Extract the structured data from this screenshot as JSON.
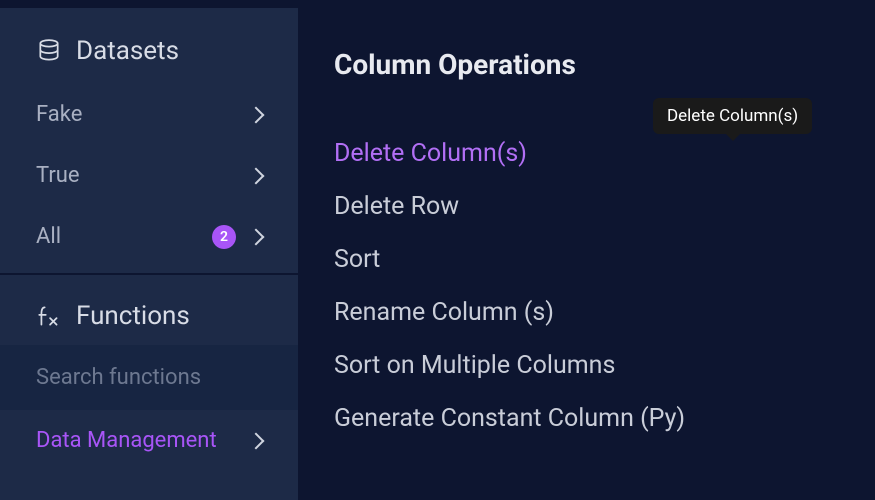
{
  "accent_color": "#a855f7",
  "sidebar": {
    "datasets": {
      "title": "Datasets",
      "items": [
        {
          "label": "Fake",
          "badge": null
        },
        {
          "label": "True",
          "badge": null
        },
        {
          "label": "All",
          "badge": "2"
        }
      ]
    },
    "functions": {
      "title": "Functions",
      "search_placeholder": "Search functions",
      "items": [
        {
          "label": "Data Management",
          "active": true
        }
      ]
    }
  },
  "main": {
    "title": "Column Operations",
    "tooltip": "Delete Column(s)",
    "operations": [
      {
        "label": "Delete Column(s)",
        "highlighted": true
      },
      {
        "label": "Delete Row",
        "highlighted": false
      },
      {
        "label": "Sort",
        "highlighted": false
      },
      {
        "label": "Rename Column (s)",
        "highlighted": false
      },
      {
        "label": "Sort on Multiple Columns",
        "highlighted": false
      },
      {
        "label": "Generate Constant Column (Py)",
        "highlighted": false
      }
    ]
  }
}
